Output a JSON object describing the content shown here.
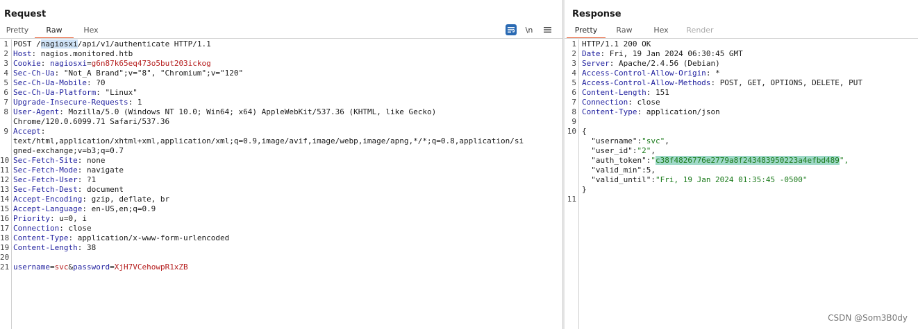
{
  "request": {
    "title": "Request",
    "tabs": [
      {
        "label": "Pretty",
        "active": false
      },
      {
        "label": "Raw",
        "active": true
      },
      {
        "label": "Hex",
        "active": false
      }
    ],
    "toolbar": {
      "wrap_icon": "text-wrap-icon",
      "newline_label": "\\n",
      "menu_icon": "hamburger-menu-icon"
    },
    "lines": [
      {
        "n": "1",
        "text": "POST /nagiosxi/api/v1/authenticate HTTP/1.1"
      },
      {
        "n": "2",
        "key": "Host",
        "sep": ": ",
        "val": "nagios.monitored.htb"
      },
      {
        "n": "3",
        "key": "Cookie",
        "sep": ": ",
        "ckey": "nagiosxi",
        "cval": "g6n87k65eq473o5but203ickog"
      },
      {
        "n": "4",
        "key": "Sec-Ch-Ua",
        "sep": ": ",
        "val": "\"Not_A Brand\";v=\"8\", \"Chromium\";v=\"120\""
      },
      {
        "n": "5",
        "key": "Sec-Ch-Ua-Mobile",
        "sep": ": ",
        "val": "?0"
      },
      {
        "n": "6",
        "key": "Sec-Ch-Ua-Platform",
        "sep": ": ",
        "val": "\"Linux\""
      },
      {
        "n": "7",
        "key": "Upgrade-Insecure-Requests",
        "sep": ": ",
        "val": "1"
      },
      {
        "n": "8",
        "key": "User-Agent",
        "sep": ": ",
        "val": "Mozilla/5.0 (Windows NT 10.0; Win64; x64) AppleWebKit/537.36 (KHTML, like Gecko)"
      },
      {
        "n": "",
        "text": "Chrome/120.0.6099.71 Safari/537.36"
      },
      {
        "n": "9",
        "key": "Accept",
        "sep": ":",
        "val": ""
      },
      {
        "n": "",
        "text": "text/html,application/xhtml+xml,application/xml;q=0.9,image/avif,image/webp,image/apng,*/*;q=0.8,application/si"
      },
      {
        "n": "",
        "text": "gned-exchange;v=b3;q=0.7"
      },
      {
        "n": "10",
        "key": "Sec-Fetch-Site",
        "sep": ": ",
        "val": "none"
      },
      {
        "n": "11",
        "key": "Sec-Fetch-Mode",
        "sep": ": ",
        "val": "navigate"
      },
      {
        "n": "12",
        "key": "Sec-Fetch-User",
        "sep": ": ",
        "val": "?1"
      },
      {
        "n": "13",
        "key": "Sec-Fetch-Dest",
        "sep": ": ",
        "val": "document"
      },
      {
        "n": "14",
        "key": "Accept-Encoding",
        "sep": ": ",
        "val": "gzip, deflate, br"
      },
      {
        "n": "15",
        "key": "Accept-Language",
        "sep": ": ",
        "val": "en-US,en;q=0.9"
      },
      {
        "n": "16",
        "key": "Priority",
        "sep": ": ",
        "val": "u=0, i"
      },
      {
        "n": "17",
        "key": "Connection",
        "sep": ": ",
        "val": "close"
      },
      {
        "n": "18",
        "key": "Content-Type",
        "sep": ": ",
        "val": "application/x-www-form-urlencoded"
      },
      {
        "n": "19",
        "key": "Content-Length",
        "sep": ": ",
        "val": "38"
      },
      {
        "n": "20",
        "text": ""
      },
      {
        "n": "21",
        "params": [
          [
            "username",
            "svc"
          ],
          [
            "password",
            "XjH7VCehowpR1xZB"
          ]
        ]
      }
    ],
    "request_line": {
      "method": "POST /",
      "selected": "nagiosxi",
      "rest": "/api/v1/authenticate HTTP/1.1"
    }
  },
  "response": {
    "title": "Response",
    "tabs": [
      {
        "label": "Pretty",
        "active": true
      },
      {
        "label": "Raw",
        "active": false
      },
      {
        "label": "Hex",
        "active": false
      },
      {
        "label": "Render",
        "active": false,
        "disabled": true
      }
    ],
    "lines": [
      {
        "n": "1",
        "text": "HTTP/1.1 200 OK"
      },
      {
        "n": "2",
        "key": "Date",
        "sep": ": ",
        "val": "Fri, 19 Jan 2024 06:30:45 GMT"
      },
      {
        "n": "3",
        "key": "Server",
        "sep": ": ",
        "val": "Apache/2.4.56 (Debian)"
      },
      {
        "n": "4",
        "key": "Access-Control-Allow-Origin",
        "sep": ": ",
        "val": "*"
      },
      {
        "n": "5",
        "key": "Access-Control-Allow-Methods",
        "sep": ": ",
        "val": "POST, GET, OPTIONS, DELETE, PUT"
      },
      {
        "n": "6",
        "key": "Content-Length",
        "sep": ": ",
        "val": "151"
      },
      {
        "n": "7",
        "key": "Connection",
        "sep": ": ",
        "val": "close"
      },
      {
        "n": "8",
        "key": "Content-Type",
        "sep": ": ",
        "val": "application/json"
      },
      {
        "n": "9",
        "text": ""
      },
      {
        "n": "10",
        "text": "{"
      },
      {
        "n": "",
        "jkey": "\"username\"",
        "jval": "\"svc\"",
        "jtail": ","
      },
      {
        "n": "",
        "jkey": "\"user_id\"",
        "jval": "\"2\"",
        "jtail": ","
      },
      {
        "n": "",
        "jkey": "\"auth_token\"",
        "jq": "\"",
        "token": "c38f4826776e2779a8f243483950223a4efbd489",
        "jtail": "\","
      },
      {
        "n": "",
        "jkey": "\"valid_min\"",
        "jnum": "5",
        "jtail": ","
      },
      {
        "n": "",
        "jkey": "\"valid_until\"",
        "jval": "\"Fri, 19 Jan 2024 01:35:45 -0500\"",
        "jtail": ""
      },
      {
        "n": "",
        "text": "}"
      },
      {
        "n": "11",
        "text": ""
      }
    ]
  },
  "watermark": "CSDN @Som3B0dy"
}
